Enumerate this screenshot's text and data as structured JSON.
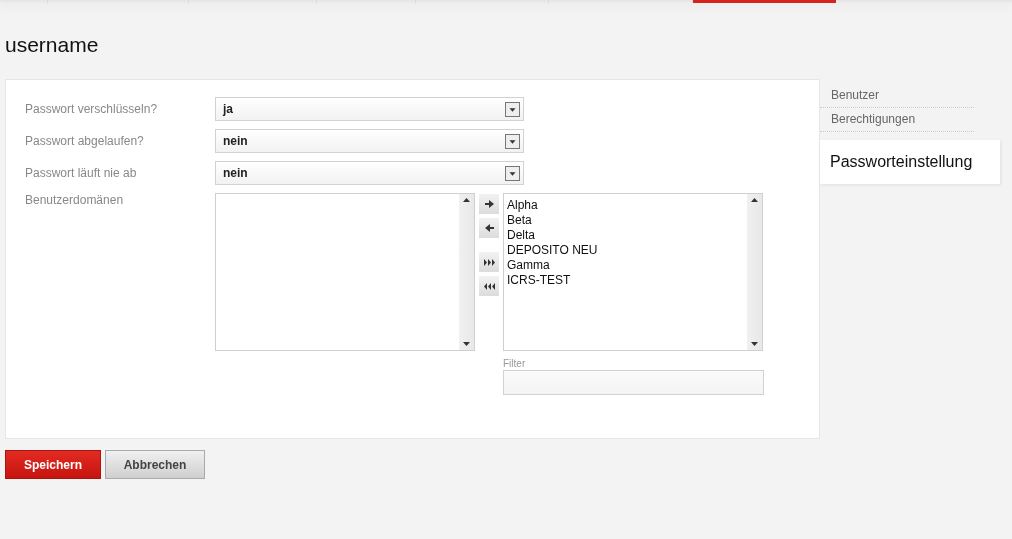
{
  "top_tabs": [
    {
      "selected": false
    },
    {
      "selected": false
    },
    {
      "selected": false
    },
    {
      "selected": false
    },
    {
      "selected": false
    },
    {
      "selected": true
    }
  ],
  "title": "username",
  "fields": [
    {
      "label": "Passwort verschlüsseln?",
      "value": "ja"
    },
    {
      "label": "Passwort abgelaufen?",
      "value": "nein"
    },
    {
      "label": "Passwort läuft nie ab",
      "value": "nein"
    }
  ],
  "domains": {
    "label": "Benutzerdomänen",
    "available_items": [
      "Alpha",
      "Beta",
      "Delta",
      "DEPOSITO NEU",
      "Gamma",
      "ICRS-TEST"
    ],
    "filter_label": "Filter"
  },
  "side_nav": [
    {
      "label": "Benutzer",
      "selected": false
    },
    {
      "label": "Berechtigungen",
      "selected": false
    },
    {
      "label": "Passworteinstellung",
      "selected": true
    }
  ],
  "buttons": [
    {
      "label": "Speichern",
      "kind": "primary"
    },
    {
      "label": "Abbrechen",
      "kind": "secondary"
    }
  ]
}
